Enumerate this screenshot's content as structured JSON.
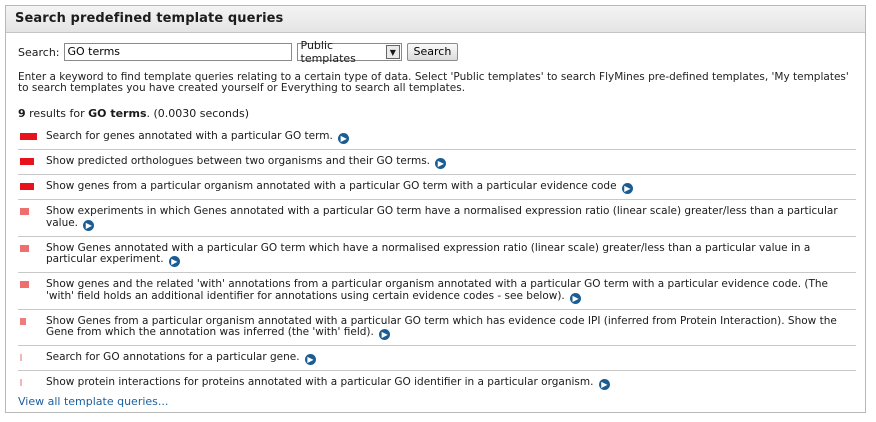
{
  "panel": {
    "title": "Search predefined template queries"
  },
  "search": {
    "label": "Search:",
    "value": "GO terms",
    "scope_selected": "Public templates",
    "button_label": "Search"
  },
  "description": "Enter a keyword to find template queries relating to a certain type of data. Select 'Public templates' to search FlyMines pre-defined templates, 'My templates' to search templates you have created yourself or Everything to search all templates.",
  "summary": {
    "count": "9",
    "mid": " results for ",
    "query": "GO terms",
    "end": ". (0.0030 seconds)"
  },
  "results": [
    {
      "text": "Search for genes annotated with a particular GO term.",
      "score_color": "#e8131a",
      "score_width": 0.21
    },
    {
      "text": "Show predicted orthologues between two organisms and their GO terms.",
      "score_color": "#e8131a",
      "score_width": 0.17
    },
    {
      "text": "Show genes from a particular organism annotated with a particular GO term with a particular evidence code",
      "score_color": "#e8131a",
      "score_width": 0.17
    },
    {
      "text": "Show experiments in which Genes annotated with a particular GO term have a normalised expression ratio (linear scale) greater/less than a particular value.",
      "score_color": "#ef6f6f",
      "score_width": 0.11
    },
    {
      "text": "Show Genes annotated with a particular GO term which have a normalised expression ratio (linear scale) greater/less than a particular value in a particular experiment.",
      "score_color": "#ef6f6f",
      "score_width": 0.11
    },
    {
      "text": "Show genes and the related 'with' annotations from a particular organism annotated with a particular GO term with a particular evidence code. (The 'with' field holds an additional identifier for annotations using certain evidence codes - see below).",
      "score_color": "#ef6f6f",
      "score_width": 0.11
    },
    {
      "text": "Show Genes from a particular organism annotated with a particular GO term which has evidence code IPI (inferred from Protein Interaction). Show the Gene from which the annotation was inferred (the 'with' field).",
      "score_color": "#ef7d7d",
      "score_width": 0.07
    },
    {
      "text": "Search for GO annotations for a particular gene.",
      "score_color": "#f2b6b6",
      "score_width": 0.03
    },
    {
      "text": "Show protein interactions for proteins annotated with a particular GO identifier in a particular organism.",
      "score_color": "#f2b6b6",
      "score_width": 0.03
    }
  ],
  "view_all_label": "View all template queries...",
  "icons": {
    "result_link": "arrow-circle-icon",
    "select_arrow": "dropdown-arrow-icon"
  }
}
